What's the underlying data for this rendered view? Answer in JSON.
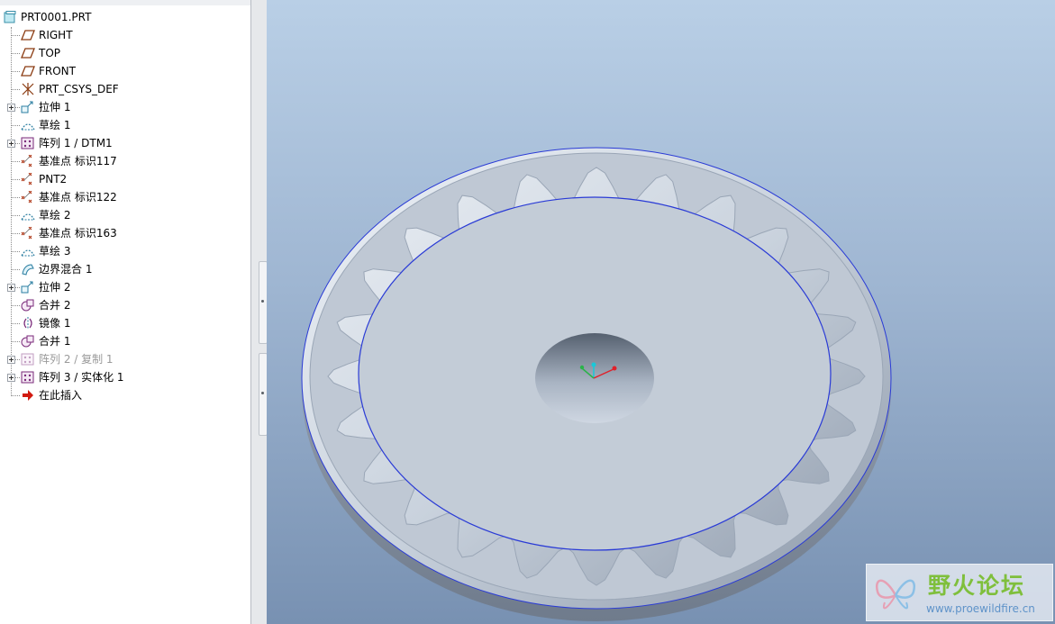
{
  "model_tree": {
    "root": {
      "label": "PRT0001.PRT",
      "icon": "part-icon"
    },
    "items": [
      {
        "label": "RIGHT",
        "icon": "datum-plane-icon",
        "expandable": false
      },
      {
        "label": "TOP",
        "icon": "datum-plane-icon",
        "expandable": false
      },
      {
        "label": "FRONT",
        "icon": "datum-plane-icon",
        "expandable": false
      },
      {
        "label": "PRT_CSYS_DEF",
        "icon": "csys-icon",
        "expandable": false
      },
      {
        "label": "拉伸 1",
        "icon": "extrude-icon",
        "expandable": true
      },
      {
        "label": "草绘 1",
        "icon": "sketch-icon",
        "expandable": false
      },
      {
        "label": "阵列 1 / DTM1",
        "icon": "pattern-icon",
        "expandable": true
      },
      {
        "label": "基准点 标识117",
        "icon": "datum-point-icon",
        "expandable": false
      },
      {
        "label": "PNT2",
        "icon": "datum-point-icon",
        "expandable": false
      },
      {
        "label": "基准点 标识122",
        "icon": "datum-point-icon",
        "expandable": false
      },
      {
        "label": "草绘 2",
        "icon": "sketch-icon",
        "expandable": false
      },
      {
        "label": "基准点 标识163",
        "icon": "datum-point-icon",
        "expandable": false
      },
      {
        "label": "草绘 3",
        "icon": "sketch-icon",
        "expandable": false
      },
      {
        "label": "边界混合 1",
        "icon": "boundary-blend-icon",
        "expandable": false
      },
      {
        "label": "拉伸 2",
        "icon": "extrude-icon",
        "expandable": true
      },
      {
        "label": "合并 2",
        "icon": "merge-icon",
        "expandable": false
      },
      {
        "label": "镜像 1",
        "icon": "mirror-icon",
        "expandable": false
      },
      {
        "label": "合并 1",
        "icon": "merge-icon",
        "expandable": false
      },
      {
        "label": "阵列 2 / 复制 1",
        "icon": "pattern-icon",
        "expandable": true,
        "suppressed": true
      },
      {
        "label": "阵列 3 / 实体化 1",
        "icon": "pattern-icon",
        "expandable": true
      },
      {
        "label": "在此插入",
        "icon": "insert-here-arrow-icon",
        "expandable": false
      }
    ]
  },
  "viewport": {
    "background_top": "#b9cfe6",
    "background_bottom": "#7891b2",
    "model_color": "#c4cdd9",
    "edge_color": "#2a3bd6"
  },
  "watermark": {
    "title": "野火论坛",
    "url": "www.proewildfire.cn"
  }
}
